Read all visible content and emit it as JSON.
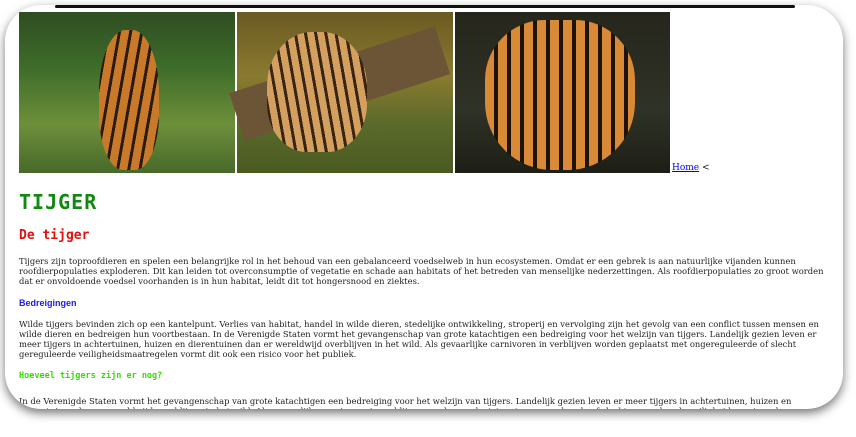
{
  "nav": {
    "home_label": "Home",
    "separator": "<"
  },
  "images": [
    {
      "alt": "Tijger loopt over pad",
      "icon": "tiger-walking-image"
    },
    {
      "alt": "Tijgerwelp op boomstam",
      "icon": "tiger-cub-image"
    },
    {
      "alt": "Tijgerkop close-up",
      "icon": "tiger-face-image"
    }
  ],
  "page": {
    "title": "TIJGER",
    "subtitle": "De tijger",
    "intro": "Tijgers zijn toproofdieren en spelen een belangrijke rol in het behoud van een gebalanceerd voedselweb in hun ecosystemen. Omdat er een gebrek is aan natuurlijke vijanden kunnen roofdierpopulaties exploderen. Dit kan leiden tot overconsumptie of vegetatie en schade aan habitats of het betreden van menselijke nederzettingen. Als roofdierpopulaties zo groot worden dat er onvoldoende voedsel voorhanden is in hun habitat, leidt dit tot hongersnood en ziektes.",
    "section1_heading": "Bedreigingen",
    "section1_text": "Wilde tijgers bevinden zich op een kantelpunt. Verlies van habitat, handel in wilde dieren, stedelijke ontwikkeling, stroperij en vervolging zijn het gevolg van een conflict tussen mensen en wilde dieren en bedreigen hun voortbestaan. In de Verenigde Staten vormt het gevangenschap van grote katachtigen een bedreiging voor het welzijn van tijgers. Landelijk gezien leven er meer tijgers in achtertuinen, huizen en dierentuinen dan er wereldwijd overblijven in het wild. Als gevaarlijke carnivoren in verblijven worden geplaatst met ongereguleerde of slecht gereguleerde veiligheidsmaatregelen vormt dit ook een risico voor het publiek.",
    "section2_heading": "Hoeveel tijgers zijn er nog?",
    "section2_text": "In de Verenigde Staten vormt het gevangenschap van grote katachtigen een bedreiging voor het welzijn van tijgers. Landelijk gezien leven er meer tijgers in achtertuinen, huizen en dierentuinen dan er wereldwijd overblijven in het wild. Als gevaarlijke carnivoren in verblijven worden geplaatst met ongereguleerde of slecht gereguleerde veiligheidsmaatregelen vormt dit ook een risico voor het publiek."
  }
}
